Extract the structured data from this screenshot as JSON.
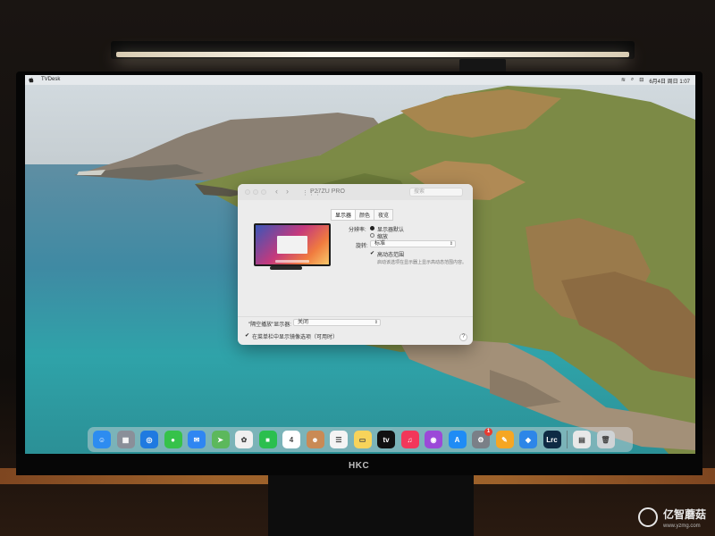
{
  "menubar": {
    "app_name": "TVDesk",
    "status_icons": [
      "wifi-icon",
      "search-icon",
      "control-center-icon"
    ],
    "datetime": "6月4日 周日 1:07"
  },
  "dialog": {
    "nav_back": "‹",
    "nav_forward": "›",
    "grid": "⋮⋮⋮",
    "title": "P27ZU PRO",
    "search_placeholder": "搜索",
    "tabs": [
      {
        "label": "显示器",
        "active": true
      },
      {
        "label": "颜色",
        "active": false
      },
      {
        "label": "夜览",
        "active": false
      }
    ],
    "resolution_label": "分辨率:",
    "resolution_options": [
      {
        "label": "显示器默认",
        "selected": true
      },
      {
        "label": "缩放",
        "selected": false
      }
    ],
    "rotation_label": "旋转:",
    "rotation_value": "标准",
    "hdr_checkbox": {
      "label": "高动态范围",
      "checked": true
    },
    "hdr_hint": "启动该选项在显示器上显示高动态范围内容。",
    "airplay_label": "\"隔空播放\"显示器:",
    "airplay_value": "关闭",
    "menu_checkbox": {
      "label": "在菜单栏中显示镜像选项（可用时）",
      "checked": true
    },
    "help": "?"
  },
  "dock": {
    "items": [
      {
        "name": "finder-icon",
        "color": "#2d8cf0",
        "glyph": "☺"
      },
      {
        "name": "launchpad-icon",
        "color": "#8a8f99",
        "glyph": "▦"
      },
      {
        "name": "safari-icon",
        "color": "#1f7ae0",
        "glyph": "◎"
      },
      {
        "name": "messages-icon",
        "color": "#36c24a",
        "glyph": "●"
      },
      {
        "name": "mail-icon",
        "color": "#2f86f2",
        "glyph": "✉"
      },
      {
        "name": "maps-icon",
        "color": "#5cb85c",
        "glyph": "➤"
      },
      {
        "name": "photos-icon",
        "color": "#f0f0f0",
        "glyph": "✿"
      },
      {
        "name": "facetime-icon",
        "color": "#2bbf4e",
        "glyph": "■"
      },
      {
        "name": "calendar-icon",
        "color": "#ffffff",
        "glyph": "4"
      },
      {
        "name": "contacts-icon",
        "color": "#c98a55",
        "glyph": "☻"
      },
      {
        "name": "reminders-icon",
        "color": "#f4f4f4",
        "glyph": "☰"
      },
      {
        "name": "notes-icon",
        "color": "#f7d35a",
        "glyph": "▭"
      },
      {
        "name": "apple-tv-icon",
        "color": "#111111",
        "glyph": "tv"
      },
      {
        "name": "music-icon",
        "color": "#f2375a",
        "glyph": "♫"
      },
      {
        "name": "podcasts-icon",
        "color": "#9b49d8",
        "glyph": "◉"
      },
      {
        "name": "app-store-icon",
        "color": "#1f8cf5",
        "glyph": "A"
      },
      {
        "name": "system-preferences-icon",
        "color": "#7a7f87",
        "glyph": "⚙"
      },
      {
        "name": "pages-icon",
        "color": "#f5a623",
        "glyph": "✎"
      },
      {
        "name": "tencent-docs-icon",
        "color": "#2d86e8",
        "glyph": "◆"
      },
      {
        "name": "lightroom-classic-icon",
        "color": "#0e2a44",
        "glyph": "Lrc"
      }
    ],
    "trailing": [
      {
        "name": "downloads-icon",
        "color": "#e8e8e8",
        "glyph": "▤"
      },
      {
        "name": "trash-icon",
        "color": "#cfd3d6",
        "glyph": "🗑"
      }
    ],
    "settings_badge": "1"
  },
  "monitor": {
    "brand": "HKC"
  },
  "watermark": {
    "text": "亿智蘑菇",
    "url": "www.yzmg.com"
  }
}
